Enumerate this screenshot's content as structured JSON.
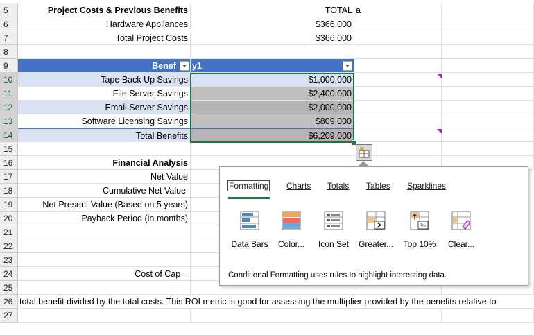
{
  "rows": [
    {
      "num": "5",
      "a": "Project Costs & Previous Benefits",
      "b": "TOTAL",
      "c": "a"
    },
    {
      "num": "6",
      "a": "Hardware Appliances",
      "b": "$366,000"
    },
    {
      "num": "7",
      "a": "Total Project Costs",
      "b": "$366,000"
    },
    {
      "num": "8",
      "a": "",
      "b": ""
    },
    {
      "num": "9",
      "a": "Benef",
      "b": "y1"
    },
    {
      "num": "10",
      "a": "Tape Back Up Savings",
      "b": "$1,000,000"
    },
    {
      "num": "11",
      "a": "File Server Savings",
      "b": "$2,400,000"
    },
    {
      "num": "12",
      "a": "Email Server Savings",
      "b": "$2,000,000"
    },
    {
      "num": "13",
      "a": "Software Licensing Savings",
      "b": "$809,000"
    },
    {
      "num": "14",
      "a": "Total Benefits",
      "b": "$6,209,000"
    },
    {
      "num": "15",
      "a": "",
      "b": ""
    },
    {
      "num": "16",
      "a": "Financial Analysis",
      "b": ""
    },
    {
      "num": "17",
      "a": "Net Value",
      "b": ""
    },
    {
      "num": "18",
      "a": "Cumulative Net Value",
      "b": ""
    },
    {
      "num": "19",
      "a": "Net Present Value (Based on 5 years)",
      "b": ""
    },
    {
      "num": "20",
      "a": "Payback Period (in months)",
      "b": ""
    },
    {
      "num": "21",
      "a": "",
      "b": ""
    },
    {
      "num": "22",
      "a": "",
      "b": ""
    },
    {
      "num": "23",
      "a": "",
      "b": ""
    },
    {
      "num": "24",
      "a": "Cost of Cap =",
      "b": ""
    },
    {
      "num": "25",
      "a": "",
      "b": ""
    },
    {
      "num": "26",
      "a": "total benefit divided by the total costs.  This ROI metric is good for assessing the multiplier provided by the benefits relative to",
      "b": ""
    },
    {
      "num": "27",
      "a": "",
      "b": ""
    }
  ],
  "quick_analysis": {
    "tabs": [
      "Formatting",
      "Charts",
      "Totals",
      "Tables",
      "Sparklines"
    ],
    "tools": [
      {
        "label": "Data Bars",
        "icon": "data-bars-icon"
      },
      {
        "label": "Color...",
        "icon": "color-scale-icon"
      },
      {
        "label": "Icon Set",
        "icon": "icon-set-icon"
      },
      {
        "label": "Greater...",
        "icon": "greater-than-icon"
      },
      {
        "label": "Top 10%",
        "icon": "top-ten-icon"
      },
      {
        "label": "Clear...",
        "icon": "clear-format-icon"
      }
    ],
    "description": "Conditional Formatting uses rules to highlight interesting data."
  },
  "colors": {
    "header_blue": "#4472c4",
    "band_light": "#d9e1f2",
    "selection_green": "#217346",
    "comment_marker": "#9b2fae"
  }
}
